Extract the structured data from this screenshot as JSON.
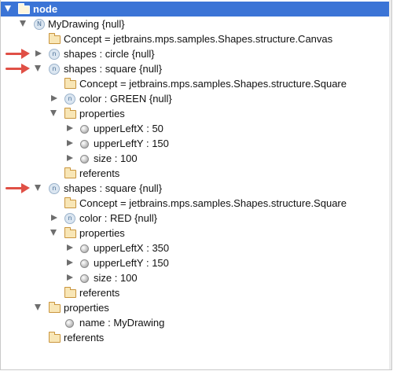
{
  "tree": {
    "root": "node",
    "my_drawing": "MyDrawing {null}",
    "concept_canvas": "Concept = jetbrains.mps.samples.Shapes.structure.Canvas",
    "shape1": "shapes : circle {null}",
    "shape2": "shapes : square {null}",
    "shape2_concept": "Concept = jetbrains.mps.samples.Shapes.structure.Square",
    "shape2_color": "color : GREEN {null}",
    "shape2_properties": "properties",
    "shape2_upperleftx": "upperLeftX : 50",
    "shape2_upperlefty": "upperLeftY : 150",
    "shape2_size": "size : 100",
    "shape2_referents": "referents",
    "shape3": "shapes : square {null}",
    "shape3_concept": "Concept = jetbrains.mps.samples.Shapes.structure.Square",
    "shape3_color": "color : RED {null}",
    "shape3_properties": "properties",
    "shape3_upperleftx": "upperLeftX : 350",
    "shape3_upperlefty": "upperLeftY : 150",
    "shape3_size": "size : 100",
    "shape3_referents": "referents",
    "drawing_properties": "properties",
    "drawing_name": "name : MyDrawing",
    "drawing_referents": "referents",
    "node_icon_letter": "N",
    "child_icon_letter": "n"
  },
  "colors": {
    "selection": "#3b74d6",
    "annotation_arrow": "#e05046"
  }
}
